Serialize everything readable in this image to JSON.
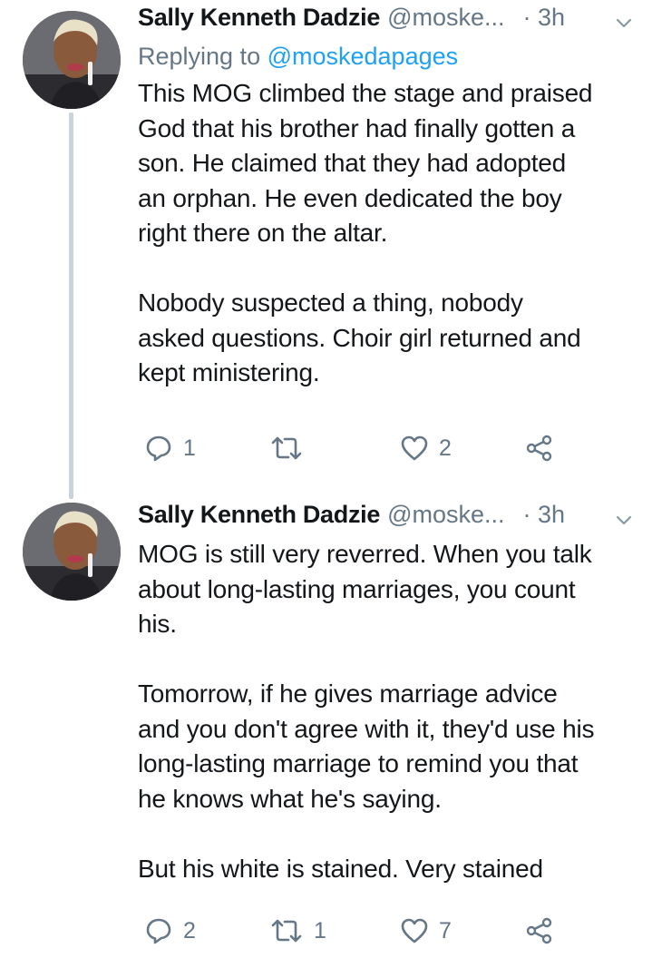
{
  "tweets": [
    {
      "author_name": "Sally Kenneth Dadzie",
      "handle": "@moske...",
      "time": "· 3h",
      "reply_prefix": "Replying to ",
      "reply_to": "@moskedapages",
      "text": "This MOG climbed the stage and praised\nGod that his brother had finally gotten a\nson. He claimed that they had adopted\nan orphan. He even dedicated the boy\nright there on the altar.\n\nNobody suspected a thing, nobody\nasked questions. Choir girl returned and\nkept ministering.",
      "reply_count": "1",
      "retweet_count": "",
      "like_count": "2"
    },
    {
      "author_name": "Sally Kenneth Dadzie",
      "handle": "@moske...",
      "time": "· 3h",
      "text": "MOG is still very reverred. When you talk\nabout long-lasting marriages, you count\nhis.\n\nTomorrow, if he gives marriage advice\nand you don't agree with it, they'd use his\nlong-lasting marriage to remind you that\nhe knows what he's saying.\n\nBut his white is stained. Very stained",
      "reply_count": "2",
      "retweet_count": "1",
      "like_count": "7"
    }
  ],
  "icons": {
    "reply": "reply-icon",
    "retweet": "retweet-icon",
    "like": "heart-icon",
    "share": "share-icon",
    "menu": "chevron-down-icon"
  },
  "colors": {
    "text": "#14171a",
    "secondary": "#657786",
    "link": "#1da1f2",
    "thread_line": "#c9d3da"
  }
}
